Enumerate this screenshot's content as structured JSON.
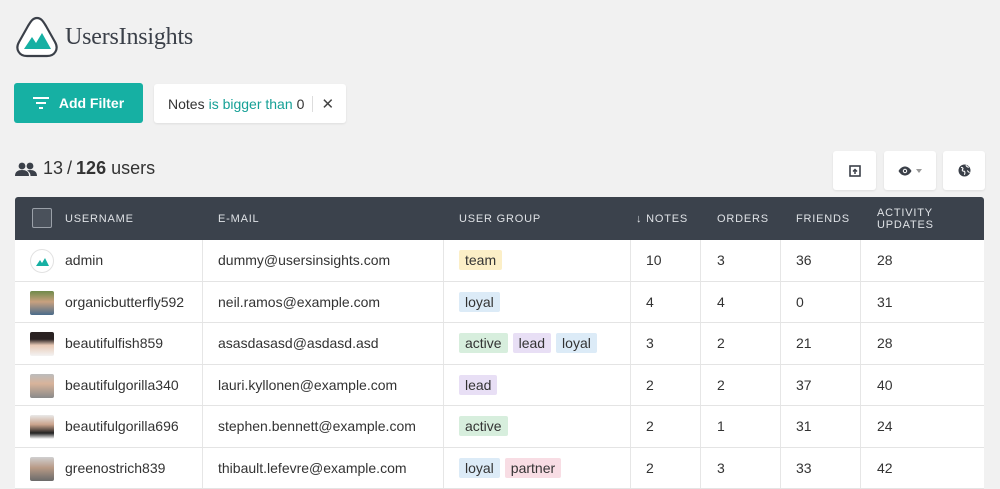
{
  "brand": {
    "name": "UsersInsights"
  },
  "toolbar": {
    "add_filter_label": "Add Filter",
    "filter": {
      "field": "Notes",
      "operator": "is bigger than",
      "value": "0"
    }
  },
  "summary": {
    "filtered": "13",
    "separator": "/",
    "total": "126",
    "unit": "users"
  },
  "table": {
    "headers": [
      "Username",
      "E-mail",
      "User Group",
      "↓ Notes",
      "Orders",
      "Friends",
      "Activity Updates"
    ],
    "rows": [
      {
        "username": "admin",
        "email": "dummy@usersinsights.com",
        "groups": [
          "team"
        ],
        "notes": "10",
        "orders": "3",
        "friends": "36",
        "activity": "28"
      },
      {
        "username": "organicbutterfly592",
        "email": "neil.ramos@example.com",
        "groups": [
          "loyal"
        ],
        "notes": "4",
        "orders": "4",
        "friends": "0",
        "activity": "31"
      },
      {
        "username": "beautifulfish859",
        "email": "asasdasasd@asdasd.asd",
        "groups": [
          "active",
          "lead",
          "loyal"
        ],
        "notes": "3",
        "orders": "2",
        "friends": "21",
        "activity": "28"
      },
      {
        "username": "beautifulgorilla340",
        "email": "lauri.kyllonen@example.com",
        "groups": [
          "lead"
        ],
        "notes": "2",
        "orders": "2",
        "friends": "37",
        "activity": "40"
      },
      {
        "username": "beautifulgorilla696",
        "email": "stephen.bennett@example.com",
        "groups": [
          "active"
        ],
        "notes": "2",
        "orders": "1",
        "friends": "31",
        "activity": "24"
      },
      {
        "username": "greenostrich839",
        "email": "thibault.lefevre@example.com",
        "groups": [
          "loyal",
          "partner"
        ],
        "notes": "2",
        "orders": "3",
        "friends": "33",
        "activity": "42"
      }
    ]
  },
  "colors": {
    "accent": "#16b0a3",
    "header_bg": "#3b424c",
    "tag_team": "#fcefc7",
    "tag_loyal": "#dcebf7",
    "tag_active": "#d7eedd",
    "tag_lead": "#e8dff5",
    "tag_partner": "#f8dde4"
  }
}
